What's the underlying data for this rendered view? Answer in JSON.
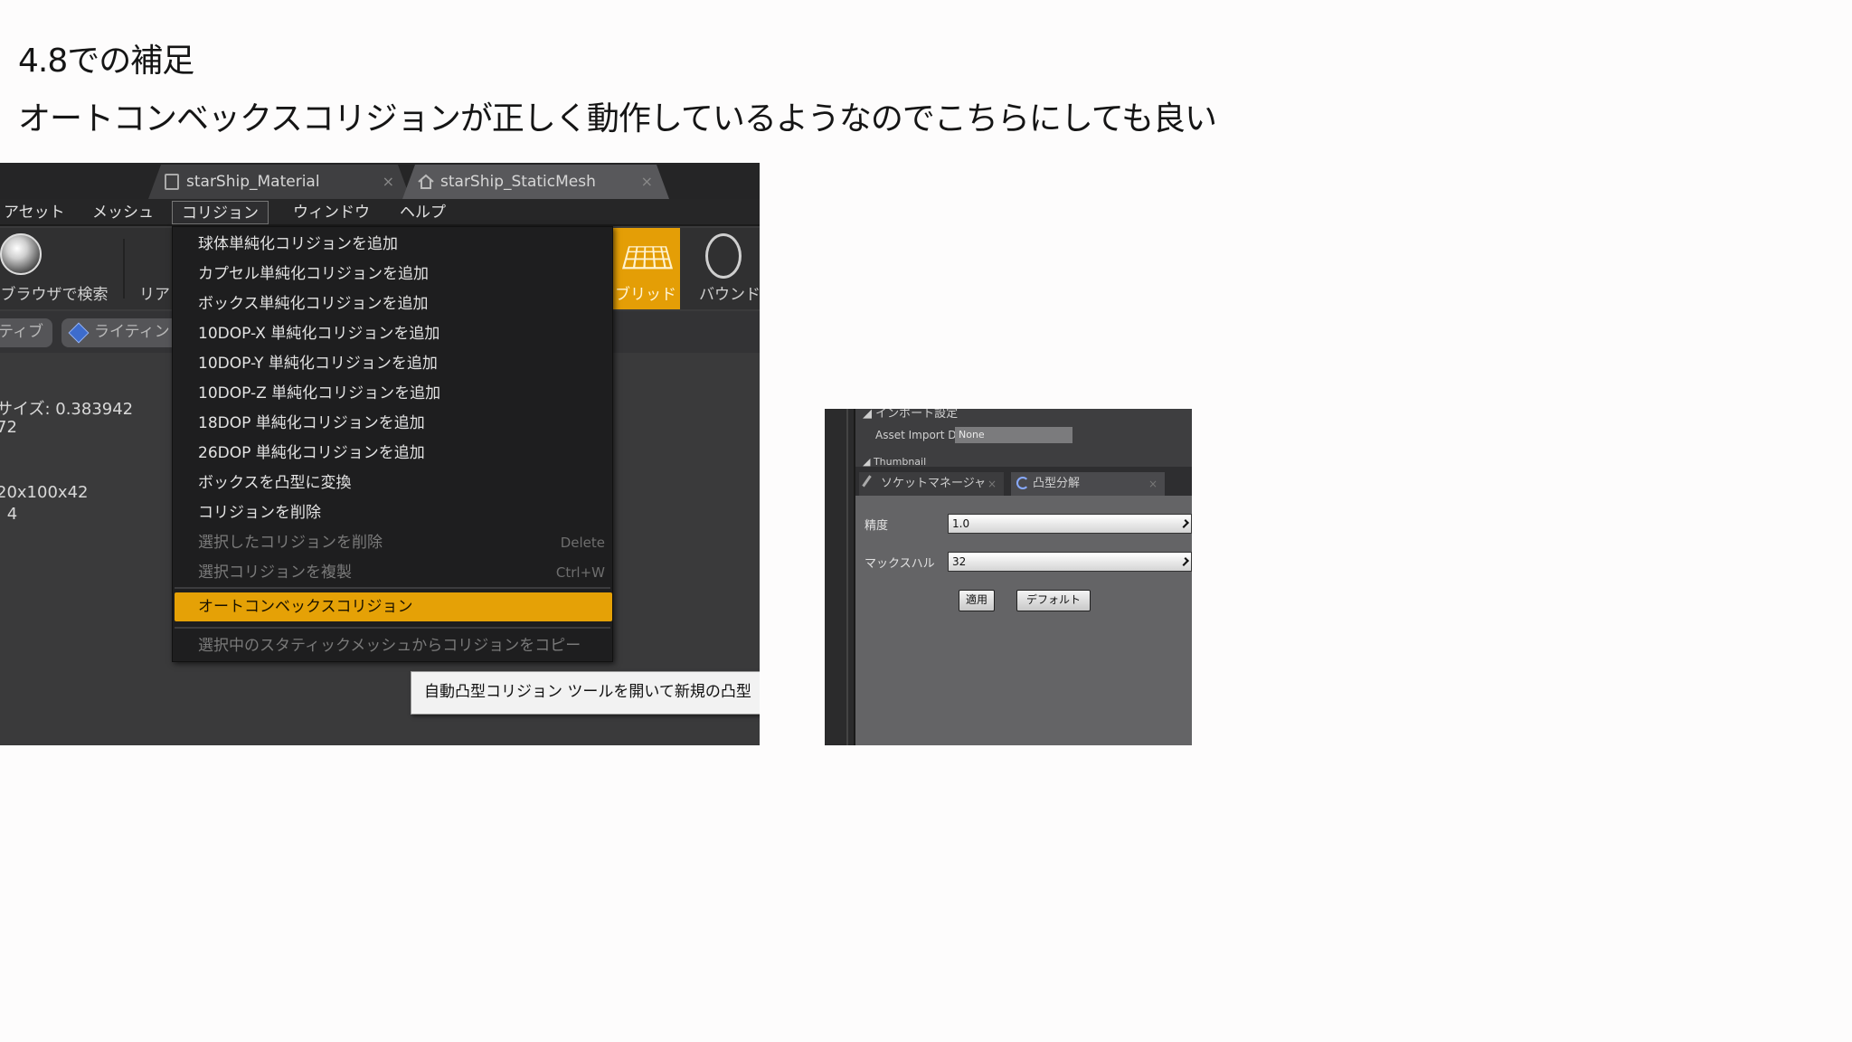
{
  "heading": {
    "line1": "4.8での補足",
    "line2": "オートコンベックスコリジョンが正しく動作しているようなのでこちらにしても良い"
  },
  "editor": {
    "tabs": [
      {
        "label": "starShip_Material",
        "close": "×"
      },
      {
        "label": "starShip_StaticMesh",
        "close": "×"
      }
    ],
    "menubar": [
      "アセット",
      "メッシュ",
      "コリジョン",
      "ウィンドウ",
      "ヘルプ"
    ],
    "toolbar": {
      "browse": "ブラウザで検索",
      "rea": "リア",
      "grid": "ブリッド",
      "bounds": "バウンド"
    },
    "viewbar": {
      "tive": "ティブ",
      "lighting": "ライティン"
    },
    "info": [
      "サイズ: 0.383942",
      "72",
      "20x100x42",
      ": 4"
    ],
    "collision_menu": {
      "items": [
        {
          "label": "球体単純化コリジョンを追加",
          "disabled": false
        },
        {
          "label": "カプセル単純化コリジョンを追加",
          "disabled": false
        },
        {
          "label": "ボックス単純化コリジョンを追加",
          "disabled": false
        },
        {
          "label": "10DOP-X 単純化コリジョンを追加",
          "disabled": false
        },
        {
          "label": "10DOP-Y 単純化コリジョンを追加",
          "disabled": false
        },
        {
          "label": "10DOP-Z 単純化コリジョンを追加",
          "disabled": false
        },
        {
          "label": "18DOP 単純化コリジョンを追加",
          "disabled": false
        },
        {
          "label": "26DOP 単純化コリジョンを追加",
          "disabled": false
        },
        {
          "label": "ボックスを凸型に変換",
          "disabled": false
        },
        {
          "label": "コリジョンを削除",
          "disabled": false
        },
        {
          "label": "選択したコリジョンを削除",
          "disabled": true,
          "shortcut": "Delete"
        },
        {
          "label": "選択コリジョンを複製",
          "disabled": true,
          "shortcut": "Ctrl+W"
        }
      ],
      "highlighted": "オートコンベックスコリジョン",
      "copy_item": "選択中のスタティックメッシュからコリジョンをコピー"
    },
    "tooltip": "自動凸型コリジョン ツールを開いて新規の凸型"
  },
  "convex_panel": {
    "import_header": "◢ インポート設定",
    "asset_import_label": "Asset Import Dat",
    "asset_import_value": "None",
    "thumbnail_header": "◢ Thumbnail",
    "tabs": [
      {
        "label": "ソケットマネージャ",
        "close": "×"
      },
      {
        "label": "凸型分解",
        "close": "×"
      }
    ],
    "accuracy_label": "精度",
    "accuracy_value": "1.0",
    "max_hulls_label": "マックスハル",
    "max_hulls_value": "32",
    "apply_button": "適用",
    "default_button": "デフォルト"
  },
  "colors": {
    "highlight": "#e5a106",
    "menu_bg": "#1e1e1f",
    "editor_bg": "#3a3a3b"
  }
}
